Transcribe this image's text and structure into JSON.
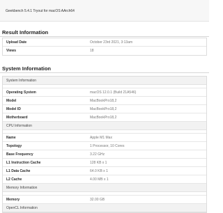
{
  "header": {
    "title": "Geekbench 5.4.1 Tryout for macOS AArch64"
  },
  "result_information": {
    "title": "Result Information",
    "rows": [
      {
        "label": "Upload Date",
        "value": "October 23rd 2021, 3:13am"
      },
      {
        "label": "Views",
        "value": "18"
      }
    ]
  },
  "system_information": {
    "title": "System Information",
    "groups": [
      {
        "heading": "System Information",
        "rows": [
          {
            "label": "Operating System",
            "value": "macOS 12.0.1 (Build 21A546)"
          },
          {
            "label": "Model",
            "value": "MacBookPro18,2"
          },
          {
            "label": "Model ID",
            "value": "MacBookPro18,2"
          },
          {
            "label": "Motherboard",
            "value": "MacBookPro18,2"
          }
        ]
      },
      {
        "heading": "CPU Information",
        "rows": [
          {
            "label": "Name",
            "value": "Apple M1 Max"
          },
          {
            "label": "Topology",
            "value": "1 Processor, 10 Cores"
          },
          {
            "label": "Base Frequency",
            "value": "3.22 GHz"
          },
          {
            "label": "L1 Instruction Cache",
            "value": "128 KB x 1"
          },
          {
            "label": "L1 Data Cache",
            "value": "64.0 KB x 1"
          },
          {
            "label": "L2 Cache",
            "value": "4.00 MB x 1"
          }
        ]
      },
      {
        "heading": "Memory Information",
        "rows": [
          {
            "label": "Memory",
            "value": "32.00 GB"
          }
        ]
      },
      {
        "heading": "OpenCL Information",
        "rows": []
      }
    ]
  }
}
